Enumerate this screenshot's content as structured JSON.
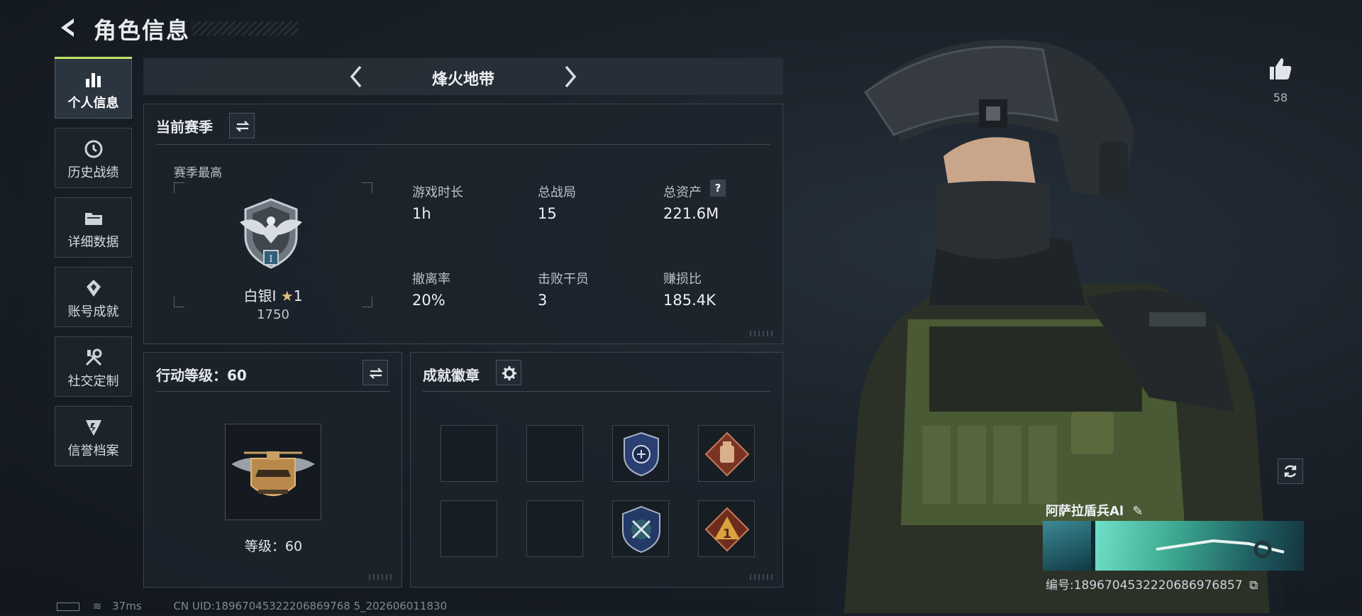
{
  "header": {
    "title": "角色信息"
  },
  "nav": {
    "items": [
      {
        "label": "个人信息",
        "icon": "bar-chart-icon",
        "active": true
      },
      {
        "label": "历史战绩",
        "icon": "history-clock-icon"
      },
      {
        "label": "详细数据",
        "icon": "folder-icon"
      },
      {
        "label": "账号成就",
        "icon": "achievement-icon"
      },
      {
        "label": "社交定制",
        "icon": "tools-icon"
      },
      {
        "label": "信誉档案",
        "icon": "reputation-icon"
      }
    ]
  },
  "mode": {
    "name": "烽火地带"
  },
  "season": {
    "title": "当前赛季",
    "best_label": "赛季最高",
    "rank_name": "白银I",
    "rank_stars": "1",
    "rank_points": "1750",
    "stats": [
      {
        "label": "游戏时长",
        "value": "1h"
      },
      {
        "label": "总战局",
        "value": "15"
      },
      {
        "label": "总资产",
        "value": "221.6M"
      },
      {
        "label": "撤离率",
        "value": "20%"
      },
      {
        "label": "击败干员",
        "value": "3"
      },
      {
        "label": "赚损比",
        "value": "185.4K"
      }
    ],
    "help_glyph": "?"
  },
  "action_level": {
    "title": "行动等级：60",
    "level_text": "等级：60"
  },
  "achievements": {
    "title": "成就徽章"
  },
  "likes": {
    "count": "58"
  },
  "character": {
    "name": "阿萨拉盾兵Al",
    "serial": "编号:1896704532220686976857"
  },
  "status_bar": {
    "ping": "37ms",
    "uid": "CN UID:18967045322206869768 5_202606011830"
  },
  "colors": {
    "accent": "#bfe36a",
    "panel_border": "#3a444f",
    "bg": "#1a2129"
  }
}
